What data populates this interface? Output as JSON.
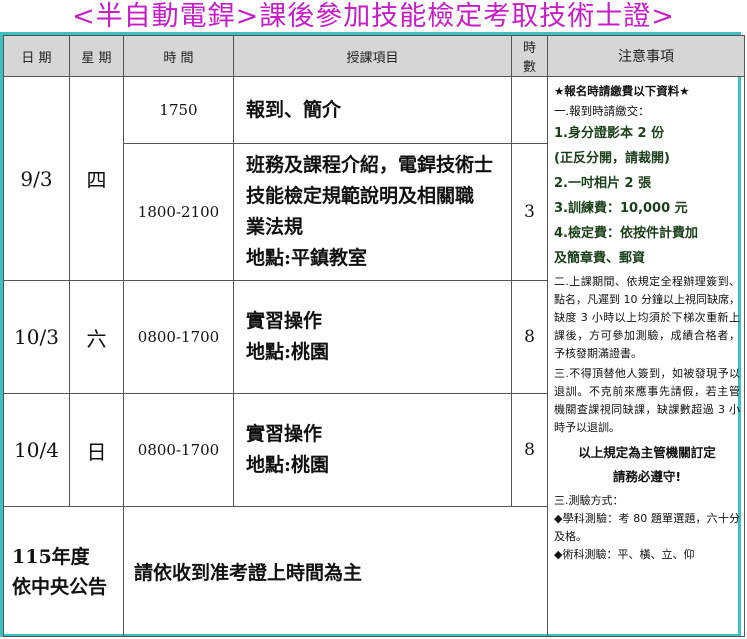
{
  "title": "<半自動電銲>課後參加技能檢定考取技術士證>",
  "headers": {
    "date": "日 期",
    "weekday": "星 期",
    "time": "時 間",
    "item": "授課項目",
    "hours_line1": "時",
    "hours_line2": "數",
    "notes": "注意事項"
  },
  "rows": [
    {
      "date": "9/3",
      "weekday": "四",
      "sessions": [
        {
          "time": "1750",
          "lines": [
            "報到、簡介"
          ]
        },
        {
          "time": "1800-2100",
          "lines": [
            "班務及課程介紹，電銲技術士",
            "技能檢定規範說明及相關職",
            "業法規",
            "地點:平鎮教室"
          ]
        }
      ],
      "hours": "3"
    },
    {
      "date": "10/3",
      "weekday": "六",
      "time": "0800-1700",
      "lines": [
        "實習操作",
        "地點:桃園"
      ],
      "hours": "8"
    },
    {
      "date": "10/4",
      "weekday": "日",
      "time": "0800-1700",
      "lines": [
        "實習操作",
        "地點:桃園"
      ],
      "hours": "8"
    }
  ],
  "final_row": {
    "left_line1": "115年度",
    "left_line2": "依中央公告",
    "text": "請依收到准考證上時間為主"
  },
  "notes": {
    "header": "★報名時請繳費以下資料★",
    "s1_title": "一.報到時請繳交：",
    "s1_items": [
      "1.身分證影本 2 份",
      "(正反分開，請裁開)",
      "2.一吋相片 2 張",
      "3.訓練費：10,000 元",
      "4.檢定費：依按件計費加",
      "及簡章費、郵資"
    ],
    "s2": "二.上課期間、依規定全程辦理簽到、點名，凡遲到 10 分鐘以上視同缺席，缺度 3 小時以上均須於下梯次重新上課後，方可參加測驗，成績合格者，予核發期滿證書。",
    "s3": "三.不得頂替他人簽到，如被發現予以退訓。不克前來應事先請假，若主管機關查課視同缺課，缺課數超過 3 小時予以退訓。",
    "rule_line1": "以上規定為主管機關訂定",
    "rule_line2": "請務必遵守!",
    "s4_title": "三.測驗方式：",
    "s4_items": [
      "◆學科測驗：考 80 題單選題，六十分及格。",
      "◆術科測驗：平、橫、立、仰"
    ]
  }
}
